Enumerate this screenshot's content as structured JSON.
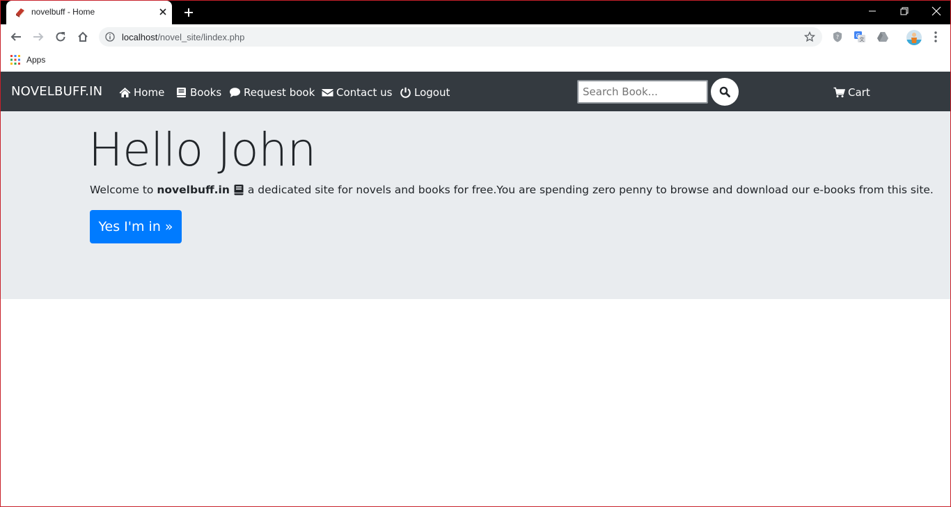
{
  "browser": {
    "tab_title": "novelbuff - Home",
    "url_host": "localhost",
    "url_path": "/novel_site/lindex.php",
    "bookmarks": [
      {
        "label": "Apps"
      }
    ]
  },
  "navbar": {
    "brand": "NOVELBUFF.IN",
    "links": [
      {
        "label": "Home",
        "icon": "home-icon"
      },
      {
        "label": "Books",
        "icon": "book-icon"
      },
      {
        "label": "Request book",
        "icon": "comment-icon"
      },
      {
        "label": "Contact us",
        "icon": "envelope-icon"
      },
      {
        "label": "Logout",
        "icon": "power-icon"
      }
    ],
    "search_placeholder": "Search Book...",
    "cart_label": "Cart",
    "background": "#343a40"
  },
  "hero": {
    "greeting": "Hello John",
    "welcome_prefix": "Welcome to",
    "site_name": "novelbuff.in",
    "welcome_suffix": "a dedicated site for novels and books for free.You are spending zero penny to browse and download our e-books from this site.",
    "button_label": "Yes I'm in »",
    "background": "#e9ecef",
    "button_color": "#007bff"
  }
}
